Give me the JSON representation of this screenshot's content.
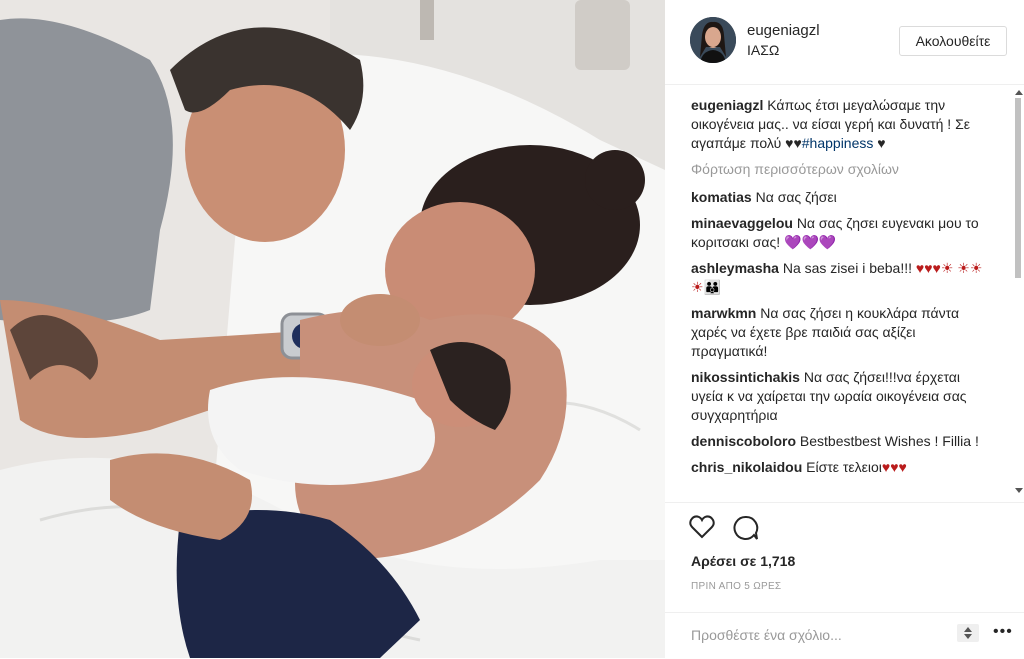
{
  "post": {
    "username": "eugeniagzl",
    "location": "ΙΑΣΩ",
    "follow_label": "Ακολουθείτε",
    "caption_user": "eugeniagzl",
    "caption_text": "Κάπως έτσι μεγαλώσαμε την οικογένεια μας.. να είσαι γερή και δυνατή ! Σε αγαπάμε πολύ ♥♥",
    "caption_hashtag": "#happiness",
    "caption_end": " ♥",
    "load_more": "Φόρτωση περισσότερων σχολίων",
    "likes": "Αρέσει σε 1,718",
    "time": "ΠΡΙΝ ΑΠΟ 5 ΩΡΕΣ",
    "add_comment_placeholder": "Προσθέστε ένα σχόλιο...",
    "more_dots": "•••"
  },
  "comments": [
    {
      "user": "komatias",
      "text": "Να σας ζήσει",
      "emoji": ""
    },
    {
      "user": "minaevaggelou",
      "text": "Να σας ζησει ευγενακι μου το κοριτσακι σας!",
      "emoji": "💜💜💜"
    },
    {
      "user": "ashleymasha",
      "text": "Na sas zisei i beba!!!",
      "emoji": "♥♥♥☀ ☀☀☀👪"
    },
    {
      "user": "marwkmn",
      "text": "Να σας ζήσει η κουκλάρα πάντα χαρές να έχετε βρε παιδιά σας αξίζει πραγματικά!",
      "emoji": ""
    },
    {
      "user": "nikossintichakis",
      "text": "Να σας ζήσει!!!να έρχεται υγεία κ να χαίρεται την ωραία οικογένεια σας συγχαρητήρια",
      "emoji": ""
    },
    {
      "user": "denniscoboloro",
      "text": "Bestbestbest Wishes ! Fillia !",
      "emoji": ""
    },
    {
      "user": "chris_nikolaidou",
      "text": "Είστε τελειοι",
      "emoji": "♥♥♥"
    }
  ],
  "icons": {
    "heart": "heart-icon",
    "comment": "comment-icon",
    "options": "more-options-icon"
  }
}
